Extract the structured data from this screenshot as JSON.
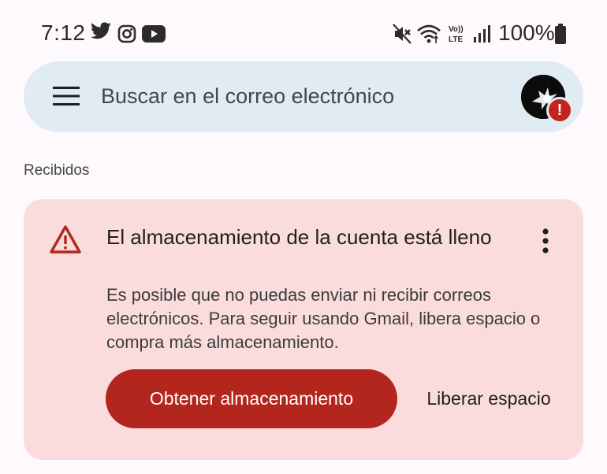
{
  "status_bar": {
    "time": "7:12",
    "battery": "100%",
    "left_icons": [
      "twitter-icon",
      "instagram-icon",
      "youtube-icon"
    ],
    "right_icons": [
      "mute-vibrate-icon",
      "wifi-icon",
      "volte-icon",
      "signal-icon",
      "battery-icon"
    ],
    "volte_label": "Vo)) LTE"
  },
  "search": {
    "placeholder": "Buscar en el correo electrónico"
  },
  "section_label": "Recibidos",
  "banner": {
    "title": "El almacenamiento de la cuenta está lleno",
    "body": "Es posible que no puedas enviar ni recibir correos electrónicos. Para seguir usando Gmail, libera espacio o compra más almacenamiento.",
    "primary_button": "Obtener almacenamiento",
    "secondary_button": "Liberar espacio"
  },
  "colors": {
    "background": "#fdf9fc",
    "search_bar": "#e1ebf2",
    "banner_bg": "#fadcdc",
    "primary": "#b3261e",
    "warning": "#b3261e"
  }
}
